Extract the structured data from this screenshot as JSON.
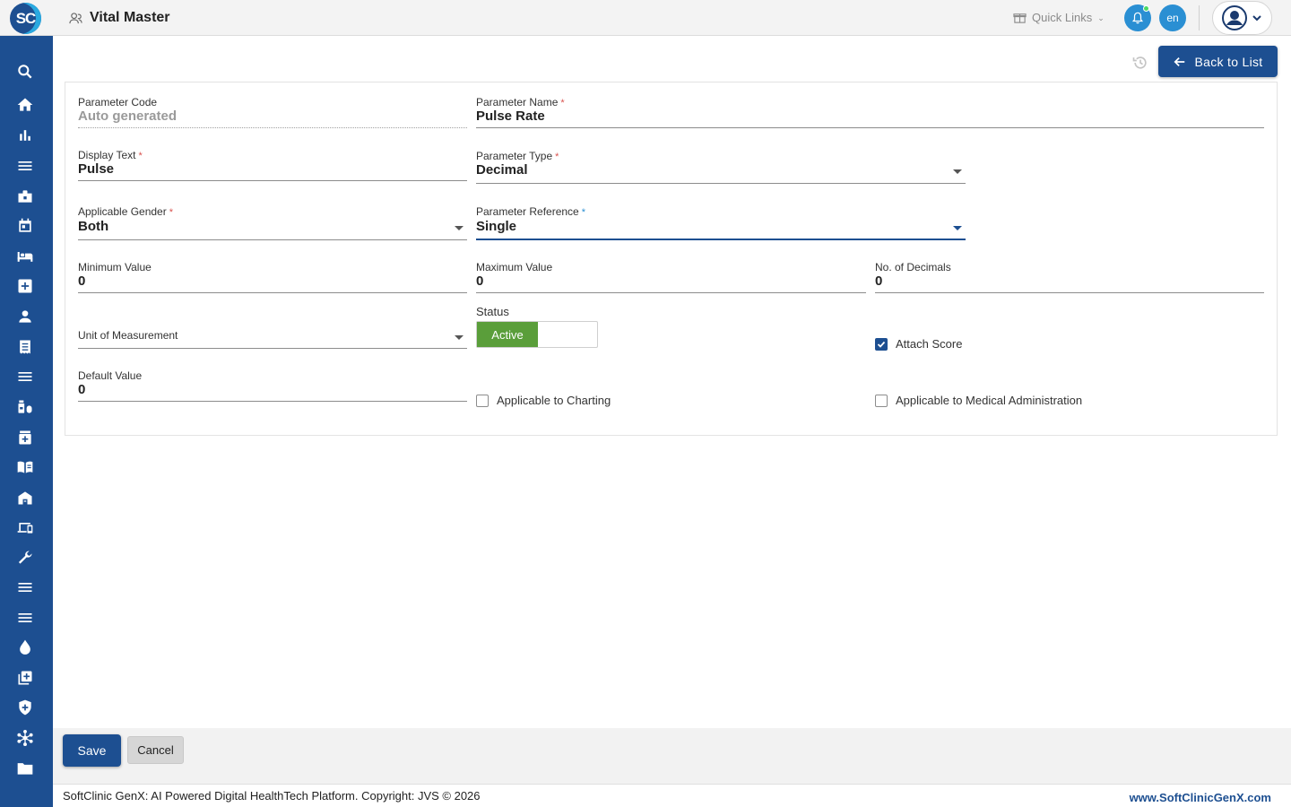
{
  "header": {
    "logo_text": "SC",
    "title": "Vital Master",
    "quick_links": "Quick Links",
    "lang": "en",
    "icons": [
      "gift-icon",
      "bell-icon",
      "user-avatar-icon",
      "chevron-down-icon"
    ]
  },
  "sidebar": {
    "items": [
      "search-icon",
      "home-icon",
      "bar-chart-icon",
      "menu-icon",
      "badge-icon",
      "calendar-icon",
      "bed-icon",
      "medical-plus-icon",
      "person-icon",
      "receipt-icon",
      "list-icon",
      "medication-icon",
      "pharmacy-icon",
      "book-icon",
      "building-icon",
      "devices-icon",
      "wrench-icon",
      "menu-icon-2",
      "menu-icon-3",
      "blood-drop-icon",
      "add-box-icon",
      "shield-icon",
      "network-icon",
      "folder-icon"
    ]
  },
  "toolbar": {
    "back_label": "Back to List"
  },
  "form": {
    "parameter_code": {
      "label": "Parameter Code",
      "placeholder": "Auto generated"
    },
    "parameter_name": {
      "label": "Parameter Name",
      "value": "Pulse Rate"
    },
    "display_text": {
      "label": "Display Text",
      "value": "Pulse"
    },
    "parameter_type": {
      "label": "Parameter Type",
      "value": "Decimal"
    },
    "applicable_gender": {
      "label": "Applicable Gender",
      "value": "Both"
    },
    "parameter_reference": {
      "label": "Parameter Reference",
      "value": "Single"
    },
    "minimum_value": {
      "label": "Minimum Value",
      "value": "0"
    },
    "maximum_value": {
      "label": "Maximum Value",
      "value": "0"
    },
    "no_of_decimals": {
      "label": "No. of Decimals",
      "value": "0"
    },
    "unit_of_measurement": {
      "label": "Unit of Measurement",
      "value": ""
    },
    "status": {
      "label": "Status",
      "value": "Active"
    },
    "attach_score": {
      "label": "Attach Score",
      "checked": true
    },
    "default_value": {
      "label": "Default Value",
      "value": "0"
    },
    "applicable_to_charting": {
      "label": "Applicable to Charting",
      "checked": false
    },
    "applicable_to_medical_admin": {
      "label": "Applicable to Medical Administration",
      "checked": false
    },
    "required_mark": "*"
  },
  "actions": {
    "save_label": "Save",
    "cancel_label": "Cancel"
  },
  "footer": {
    "copyright": "SoftClinic GenX: AI Powered Digital HealthTech Platform. Copyright: JVS © 2026",
    "link": "www.SoftClinicGenX.com"
  },
  "colors": {
    "primary": "#1d4f91",
    "accent": "#2a8fd3",
    "active_status": "#5a9e3a",
    "required": "#d9534f"
  }
}
